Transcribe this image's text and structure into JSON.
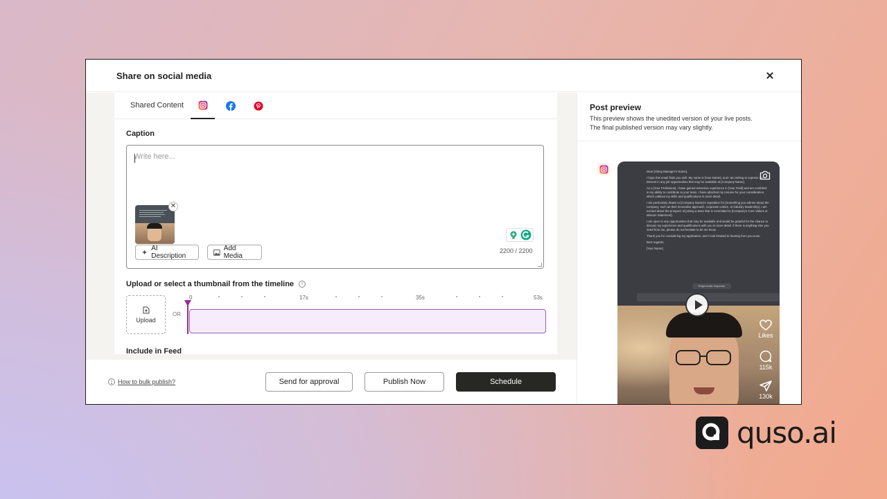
{
  "modal": {
    "title": "Share on social media"
  },
  "tabs": {
    "shared_content_label": "Shared Content",
    "icons": [
      "instagram-icon",
      "facebook-icon",
      "pinterest-icon"
    ],
    "active": "instagram"
  },
  "caption": {
    "label": "Caption",
    "placeholder": "Write here...",
    "value": "",
    "counter": "2200 / 2200",
    "ai_description_label": "AI Description",
    "add_media_label": "Add Media"
  },
  "thumbnail": {
    "label": "Upload or select a thumbnail from the timeline",
    "upload_label": "Upload",
    "or_label": "OR",
    "ticks": [
      "0",
      "17s",
      "35s",
      "53s"
    ]
  },
  "feed": {
    "label": "Include in Feed"
  },
  "footer": {
    "bulk_link": "How to bulk publish?",
    "send_approval": "Send for approval",
    "publish_now": "Publish Now",
    "schedule": "Schedule"
  },
  "preview": {
    "title": "Post preview",
    "desc_line1": "This preview shows the unedited version of your live posts.",
    "desc_line2": "The final published version may vary slightly.",
    "doc_paragraphs": [
      "Dear [Hiring Manager's Name],",
      "I hope this email finds you well. My name is [Your Name], and I am writing to express my interest in any job opportunities that may be available at [Company Name].",
      "As a [Your Profession], I have gained extensive experience in [Your Field] and am confident in my ability to contribute to your team. I have attached my resume for your consideration, which outlines my skills and qualifications in more detail.",
      "I am particularly drawn to [Company Name]'s reputation for [Something you admire about the company, such as their innovative approach, corporate culture, or industry leadership]. I am excited about the prospect of joining a team that is committed to [Company's Core Values or Mission Statement].",
      "I am open to any opportunities that may be available and would be grateful for the chance to discuss my experience and qualifications with you in more detail. If there is anything else you need from me, please do not hesitate to let me know.",
      "Thank you for considering my application, and I look forward to hearing from you soon.",
      "Best regards,",
      "[Your Name]"
    ],
    "regenerate_label": "Regenerate response",
    "likes_label": "Likes",
    "comments_count": "115k",
    "shares_count": "130k"
  },
  "brand": {
    "logo_text": "quso.ai"
  },
  "colors": {
    "accent_purple": "#9b2c8b",
    "dark_button": "#272724",
    "timeline_fill": "#f7ecfb"
  }
}
